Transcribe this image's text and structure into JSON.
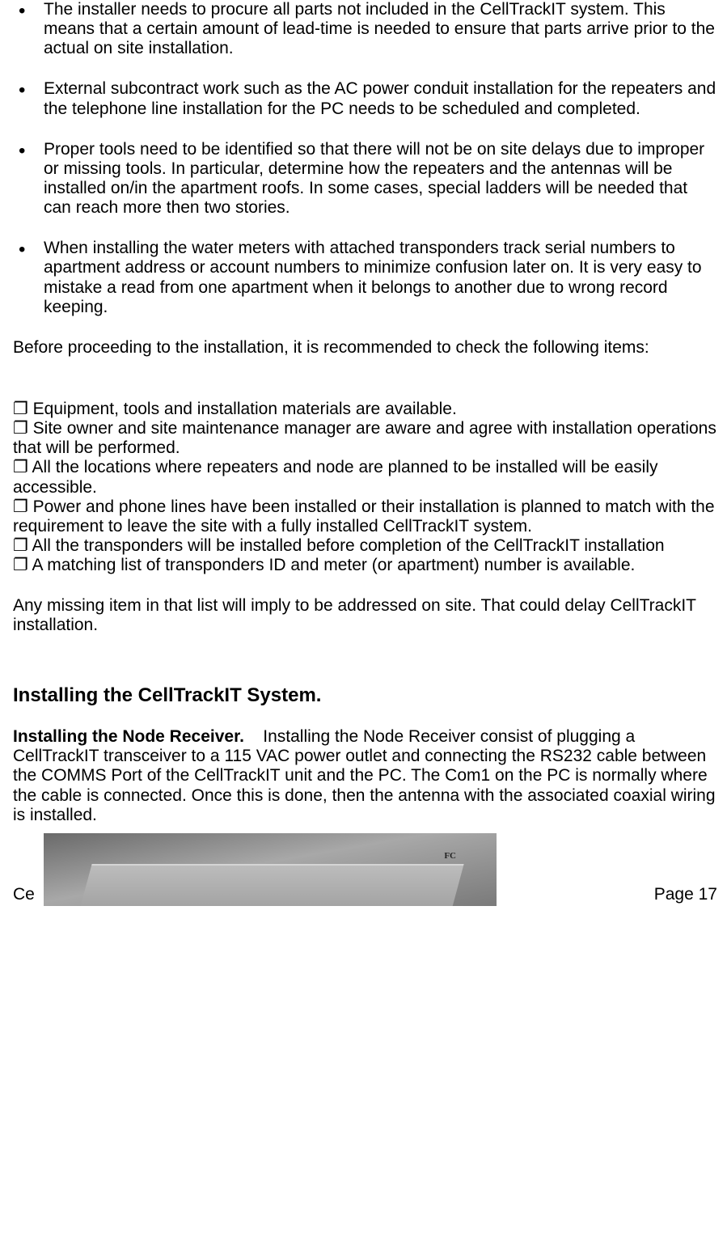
{
  "bullets": [
    "The installer needs to procure all parts not included in the CellTrackIT system. This means that a certain amount of lead-time is needed to ensure that parts arrive prior to the actual on site installation.",
    "External subcontract work such as the AC power conduit installation for the repeaters and the telephone line installation for the PC needs to be scheduled and completed.",
    "Proper tools need to be identified so that there will not be on site delays due to improper or missing tools. In particular, determine how the repeaters and the antennas will be installed on/in the apartment roofs. In some cases, special ladders will be needed that can reach more then two stories.",
    "When installing the water meters with attached transponders track serial numbers to apartment address or account numbers to minimize confusion later on. It is very easy to mistake a read from one apartment when it belongs to another due to wrong record keeping."
  ],
  "intro_after_bullets": "Before proceeding to the installation, it is recommended to check the following items:",
  "check_marker": "❐",
  "checks": [
    "Equipment, tools and installation materials are available.",
    "Site owner and site maintenance manager are aware and agree with installation operations that will be performed.",
    "All the locations where repeaters and node are planned to be installed will be easily accessible.",
    "Power and phone lines have been installed or their installation is planned to match with the requirement to leave the site with a fully installed CellTrackIT system.",
    "All the transponders will be installed before completion of the CellTrackIT installation",
    "A matching list of transponders ID and meter (or apartment) number is available."
  ],
  "post_check": "Any missing item in that list will imply to be addressed on site. That could delay CellTrackIT installation.",
  "heading": "Installing the CellTrackIT System.",
  "node_heading": "Installing the Node Receiver.",
  "node_body": "Installing the Node Receiver consist of plugging a CellTrackIT transceiver to a 115 VAC power outlet and connecting the RS232 cable between the COMMS Port of the CellTrackIT unit and the PC.  The Com1 on the PC is normally where the cable is connected. Once this is done, then the antenna with the associated coaxial wiring is installed.",
  "fc_text": "FC",
  "footer_left": "Ce",
  "footer_right": "Page 17"
}
